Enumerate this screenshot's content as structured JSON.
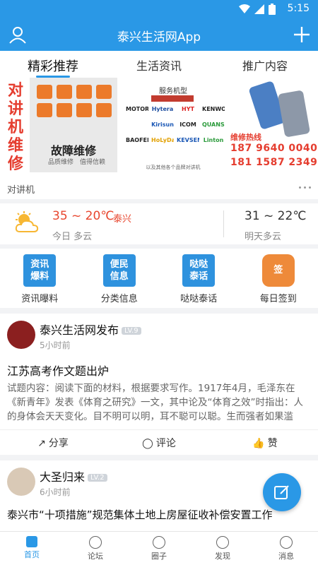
{
  "status_bar": {
    "time": "5:15"
  },
  "app_bar": {
    "title": "泰兴生活网App",
    "left_icon": "user-icon",
    "right_icon": "plus-icon"
  },
  "tabs": [
    {
      "label": "精彩推荐",
      "active": true
    },
    {
      "label": "生活资讯",
      "active": false
    },
    {
      "label": "推广内容",
      "active": false
    }
  ],
  "banner": {
    "left_vertical_text": "对讲机维修",
    "fault_title": "故障维修",
    "fault_sub": "品质维修　值得信赖",
    "service_title": "服务机型",
    "brands": [
      "MOTOROLA",
      "Hytera",
      "HYT",
      "KENWOOD",
      "",
      "Kirisun",
      "ICOM",
      "QUANSHENG",
      "BAOFENG",
      "HoLyDa",
      "KEVSEN",
      "Linton"
    ],
    "service_foot": "以及其他各个品牌对讲机",
    "hotline_label": "维修热线",
    "phones": [
      "187 9640 0040",
      "181 1587 2349"
    ],
    "caption": "对讲机"
  },
  "weather": {
    "today_temp": "35 ~ 20℃",
    "city": "泰兴",
    "today_desc": "今日 多云",
    "tomorrow_temp": "31 ~ 22℃",
    "tomorrow_desc": "明天多云",
    "icon": "partly-cloudy-icon"
  },
  "shortcuts": [
    {
      "icon_text": "资讯\n爆料",
      "label": "资讯曝料"
    },
    {
      "icon_text": "便民\n信息",
      "label": "分类信息"
    },
    {
      "icon_text": "哒哒\n泰话",
      "label": "哒哒泰话"
    },
    {
      "icon_text": "签",
      "label": "每日签到"
    }
  ],
  "posts": [
    {
      "author": "泰兴生活网发布",
      "level": "LV.9",
      "time": "5小时前",
      "title": "江苏高考作文题出炉",
      "body": "试题内容：阅读下面的材料，根据要求写作。1917年4月，毛泽东在《新青年》发表《体育之研究》一文，其中论及“体育之效”时指出：人的身体会天天变化。目不明可以明，耳不聪可以聪。生而强者如果滥",
      "actions": {
        "share": "分享",
        "comment": "评论",
        "like": "赞"
      }
    },
    {
      "author": "大圣归来",
      "level": "LV.2",
      "time": "6小时前",
      "title": "泰兴市“十项措施”规范集体土地上房屋征收补偿安置工作"
    }
  ],
  "bottom_nav": [
    {
      "label": "首页",
      "active": true
    },
    {
      "label": "论坛",
      "active": false
    },
    {
      "label": "圈子",
      "active": false
    },
    {
      "label": "发现",
      "active": false
    },
    {
      "label": "消息",
      "active": false
    }
  ],
  "colors": {
    "primary": "#2a98e6",
    "accent_red": "#e53d2f",
    "orange": "#ec7a2a"
  }
}
